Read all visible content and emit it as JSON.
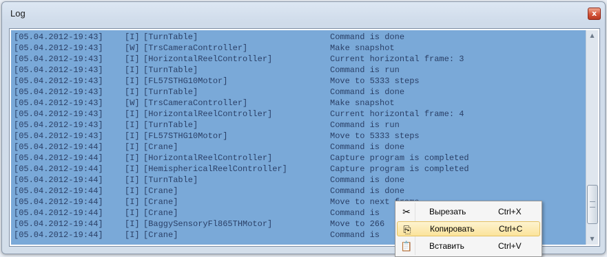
{
  "window": {
    "title": "Log",
    "close_label": "x"
  },
  "log": {
    "selection_color": "#7aa9d8",
    "text_color": "#2a3f66",
    "lines": [
      {
        "time": "[05.04.2012-19:43]",
        "level": "[I]",
        "source": "[TurnTable]",
        "message": "Command is done"
      },
      {
        "time": "[05.04.2012-19:43]",
        "level": "[W]",
        "source": "[TrsCameraController]",
        "message": "Make snapshot"
      },
      {
        "time": "[05.04.2012-19:43]",
        "level": "[I]",
        "source": "[HorizontalReelController]",
        "message": "Current horizontal frame: 3"
      },
      {
        "time": "[05.04.2012-19:43]",
        "level": "[I]",
        "source": "[TurnTable]",
        "message": "Command is run"
      },
      {
        "time": "[05.04.2012-19:43]",
        "level": "[I]",
        "source": "[FL57STHG10Motor]",
        "message": "Move to 5333 steps"
      },
      {
        "time": "[05.04.2012-19:43]",
        "level": "[I]",
        "source": "[TurnTable]",
        "message": "Command is done"
      },
      {
        "time": "[05.04.2012-19:43]",
        "level": "[W]",
        "source": "[TrsCameraController]",
        "message": "Make snapshot"
      },
      {
        "time": "[05.04.2012-19:43]",
        "level": "[I]",
        "source": "[HorizontalReelController]",
        "message": "Current horizontal frame: 4"
      },
      {
        "time": "[05.04.2012-19:43]",
        "level": "[I]",
        "source": "[TurnTable]",
        "message": "Command is run"
      },
      {
        "time": "[05.04.2012-19:43]",
        "level": "[I]",
        "source": "[FL57STHG10Motor]",
        "message": "Move to 5333 steps"
      },
      {
        "time": "[05.04.2012-19:44]",
        "level": "[I]",
        "source": "[Crane]",
        "message": "Command is done"
      },
      {
        "time": "[05.04.2012-19:44]",
        "level": "[I]",
        "source": "[HorizontalReelController]",
        "message": "Capture program is completed"
      },
      {
        "time": "[05.04.2012-19:44]",
        "level": "[I]",
        "source": "[HemisphericalReelController]",
        "message": "Capture program is completed"
      },
      {
        "time": "[05.04.2012-19:44]",
        "level": "[I]",
        "source": "[TurnTable]",
        "message": "Command is done"
      },
      {
        "time": "[05.04.2012-19:44]",
        "level": "[I]",
        "source": "[Crane]",
        "message": "Command is done"
      },
      {
        "time": "[05.04.2012-19:44]",
        "level": "[I]",
        "source": "[Crane]",
        "message": "Move to next frame"
      },
      {
        "time": "[05.04.2012-19:44]",
        "level": "[I]",
        "source": "[Crane]",
        "message": "Command is"
      },
      {
        "time": "[05.04.2012-19:44]",
        "level": "[I]",
        "source": "[BaggySensoryFl865THMotor]",
        "message": "Move to 266"
      },
      {
        "time": "[05.04.2012-19:44]",
        "level": "[I]",
        "source": "[Crane]",
        "message": "Command is"
      }
    ]
  },
  "scrollbar": {
    "up_icon": "scroll-up-arrow-icon",
    "down_icon": "scroll-down-arrow-icon",
    "up_glyph": "▲",
    "down_glyph": "▼"
  },
  "context_menu": {
    "items": [
      {
        "label": "Вырезать",
        "shortcut": "Ctrl+X",
        "icon": "scissors-icon",
        "glyph": "✂",
        "highlighted": false
      },
      {
        "label": "Копировать",
        "shortcut": "Ctrl+C",
        "icon": "copy-icon",
        "glyph": "⎘",
        "highlighted": true
      },
      {
        "label": "Вставить",
        "shortcut": "Ctrl+V",
        "icon": "paste-icon",
        "glyph": "📋",
        "highlighted": false
      }
    ]
  }
}
